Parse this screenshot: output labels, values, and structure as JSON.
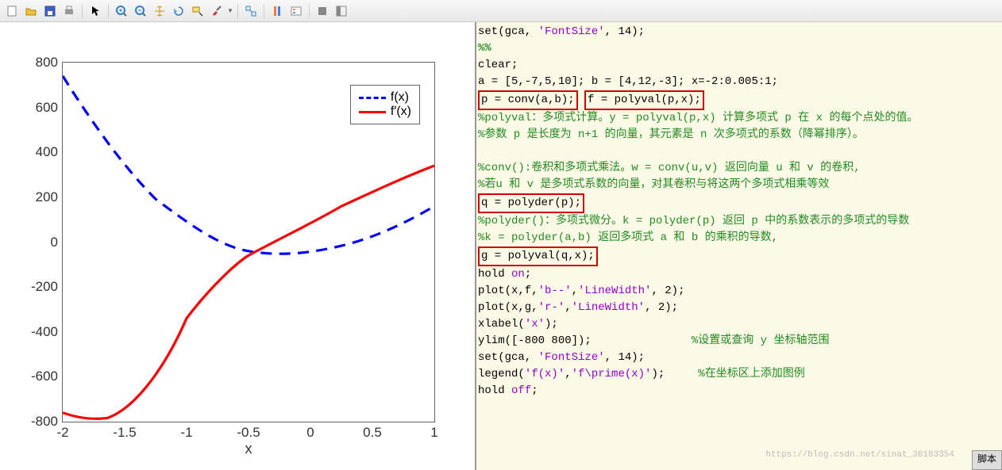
{
  "toolbar_icons": [
    "new-icon",
    "open-icon",
    "save-icon",
    "print-icon",
    "arrow-icon",
    "zoom-in-icon",
    "zoom-out-icon",
    "pan-icon",
    "rotate-icon",
    "data-cursor-icon",
    "brush-icon",
    "link-icon",
    "colorbar-icon",
    "legend-icon",
    "dock-icon",
    "undock-icon",
    "tile-icon"
  ],
  "chart_data": {
    "type": "line",
    "x": [
      -2,
      -1.5,
      -1,
      -0.5,
      0,
      0.5,
      1
    ],
    "series": [
      {
        "name": "f(x)",
        "style": "b--",
        "values": [
          740,
          330,
          90,
          -40,
          -50,
          30,
          160
        ]
      },
      {
        "name": "f′(x)",
        "style": "r-",
        "values": [
          -760,
          -620,
          -340,
          -60,
          80,
          200,
          340
        ]
      }
    ],
    "xlabel": "x",
    "ylabel": "",
    "ylim": [
      -800,
      800
    ],
    "xlim": [
      -2,
      1
    ],
    "y_ticks": [
      -800,
      -600,
      -400,
      -200,
      0,
      200,
      400,
      600,
      800
    ],
    "x_ticks": [
      -2,
      -1.5,
      -1,
      -0.5,
      0,
      0.5,
      1
    ],
    "legend": [
      "f(x)",
      "f′(x)"
    ]
  },
  "legend_item1": "f(x)",
  "legend_item2": "f′(x)",
  "xlabel": "x",
  "code_lines": {
    "l1_pre": "set(gca, ",
    "l1_str": "'FontSize'",
    "l1_post": ", 14);",
    "l2": "%%",
    "l3": "clear;",
    "l4": "a = [5,-7,5,10]; b = [4,12,-3]; x=-2:0.005:1;",
    "l5_box1": "p = conv(a,b);",
    "l5_box2": "f = polyval(p,x);",
    "l6": "%polyval：多项式计算。y = polyval(p,x) 计算多项式 p 在 x 的每个点处的值。",
    "l7": "%参数 p 是长度为 n+1 的向量，其元素是 n 次多项式的系数（降幂排序）。",
    "l8": "",
    "l9": "%conv():卷积和多项式乘法。w = conv(u,v) 返回向量 u 和 v 的卷积,",
    "l10": "%若u 和 v 是多项式系数的向量，对其卷积与将这两个多项式相乘等效",
    "l11_box": "q = polyder(p);",
    "l12": "%polyder()：多项式微分。k = polyder(p) 返回 p 中的系数表示的多项式的导数",
    "l13": "%k = polyder(a,b) 返回多项式 a 和 b 的乘积的导数,",
    "l14_box": "g = polyval(q,x);",
    "l15": "hold ",
    "l15b": "on",
    "l15c": ";",
    "l16a": "plot(x,f,",
    "l16b": "'b--'",
    "l16c": ",",
    "l16d": "'LineWidth'",
    "l16e": ", 2);",
    "l17a": "plot(x,g,",
    "l17b": "'r-'",
    "l17c": ",",
    "l17d": "'LineWidth'",
    "l17e": ", 2);",
    "l18a": "xlabel(",
    "l18b": "'x'",
    "l18c": ");",
    "l19a": "ylim([-800 800]);",
    "l19b": "               %设置或查询 y 坐标轴范围",
    "l20a": "set(gca, ",
    "l20b": "'FontSize'",
    "l20c": ", 14);",
    "l21a": "legend(",
    "l21b": "'f(x)'",
    "l21c": ",",
    "l21d": "'f\\prime(x)'",
    "l21e": ");",
    "l21f": "     %在坐标区上添加图例",
    "l22a": "hold ",
    "l22b": "off",
    "l22c": ";"
  },
  "status_text": "脚本",
  "watermark_text": "https://blog.csdn.net/sinat_36183354"
}
